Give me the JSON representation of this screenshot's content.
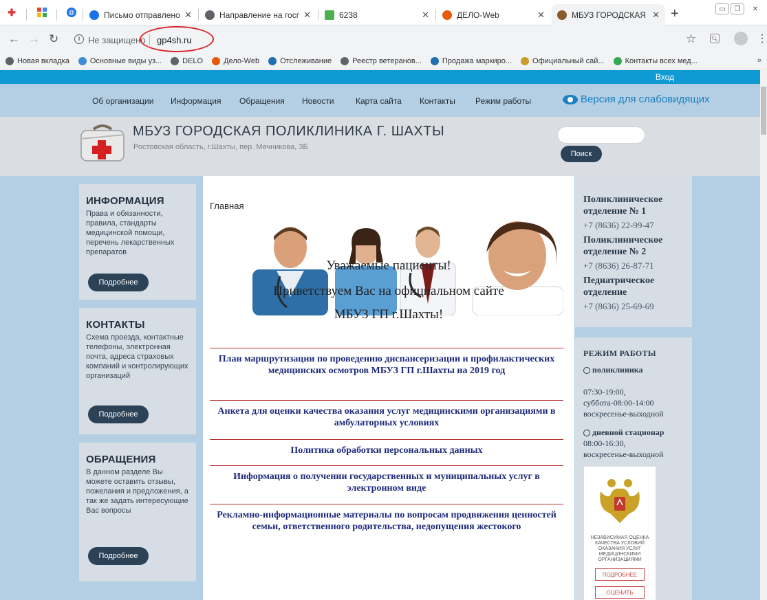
{
  "browser": {
    "tabs": [
      {
        "label": "Письмо отправлено - П",
        "favicon_color": "#1a73e8"
      },
      {
        "label": "Направление на госпит",
        "favicon_color": "#5f6368"
      },
      {
        "label": "6238",
        "favicon_color": "#4caf50"
      },
      {
        "label": "ДЕЛО-Web",
        "favicon_color": "#e8590c"
      },
      {
        "label": "МБУЗ ГОРОДСКАЯ ПОЛ",
        "favicon_color": "#8a5a2b"
      }
    ],
    "new_tab_label": "+",
    "security_text": "Не защищено",
    "url": "gp4sh.ru",
    "bookmarks": [
      {
        "label": "Новая вкладка",
        "color": "#5f6368"
      },
      {
        "label": "Основные виды уз...",
        "color": "#3d8bd6"
      },
      {
        "label": "DELO",
        "color": "#5f6368"
      },
      {
        "label": "Дело-Web",
        "color": "#e8590c"
      },
      {
        "label": "Отслеживание",
        "color": "#1f6fb2"
      },
      {
        "label": "Реестр ветеранов...",
        "color": "#5f6368"
      },
      {
        "label": "Продажа маркиро...",
        "color": "#1f6fb2"
      },
      {
        "label": "Официальный сай...",
        "color": "#c89b2b"
      },
      {
        "label": "Контакты всех мед...",
        "color": "#35a853"
      }
    ],
    "bookmarks_more": "»"
  },
  "site": {
    "login": "Вход",
    "nav": [
      "Об организации",
      "Информация",
      "Обращения",
      "Новости",
      "Карта сайта",
      "Контакты",
      "Режим работы"
    ],
    "accessibility": "Версия для слабовидящих",
    "title": "МБУЗ ГОРОДСКАЯ ПОЛИКЛИНИКА Г. ШАХТЫ",
    "address": "Ростовская область, г.Шахты, пер. Мечникова, 3Б",
    "search_button": "Поиск",
    "left_cards": [
      {
        "title": "ИНФОРМАЦИЯ",
        "text": "Права и обязанности, правила, стандарты медицинской помощи, перечень лекарственных препаратов",
        "button": "Подробнее"
      },
      {
        "title": "КОНТАКТЫ",
        "text": "Схема проезда, контактные телефоны, электронная почта, адреса страховых компаний и контролирующих организаций",
        "button": "Подробнее"
      },
      {
        "title": "ОБРАЩЕНИЯ",
        "text": "В данном разделе Вы можете оставить отзывы, пожелания и предложения, а так же задать интересующие Вас вопросы",
        "button": "Подробнее"
      }
    ],
    "breadcrumb": "Главная",
    "greeting": [
      "Уважаемые пациенты!",
      "Приветствуем Вас на официальном сайте",
      "МБУЗ ГП г.Шахты!"
    ],
    "links": [
      "План маршрутизации по проведению диспансеризации и профилактических медицинских осмотров МБУЗ ГП г.Шахты на 2019 год",
      "Анкета для оценки качества оказания услуг медицинскими организациями в амбулаторных условиях",
      "Политика обработки персональных данных",
      "Информация о получении государственных и муниципальных услуг в электронном виде",
      "Рекламно-информационные материалы по вопросам продвижения ценностей семьи, ответственного родительства, недопущения жестокого"
    ],
    "departments": [
      {
        "name": "Поликлиническое отделение № 1",
        "phone": "+7 (8636) 22-99-47"
      },
      {
        "name": "Поликлиническое отделение № 2",
        "phone": "+7 (8636) 26-87-71"
      },
      {
        "name": "Педиатрическое отделение",
        "phone": "+7 (8636) 25-69-69"
      }
    ],
    "hours": {
      "title": "РЕЖИМ РАБОТЫ",
      "clinic_label": "поликлиника",
      "clinic_lines": [
        "07:30-19:00,",
        "суббота-08:00-14:00",
        "воскресенье-выходной"
      ],
      "daycare_label": "дневной стационар",
      "daycare_lines": [
        "08:00-16:30,",
        "воскресенье-выходной"
      ]
    },
    "badge": {
      "text": "Независимая оценка качества условий оказания услуг медицинскими организациями",
      "more": "ПОДРОБНЕЕ",
      "rate": "ОЦЕНИТЬ"
    }
  },
  "colors": {
    "top_strip": "#0f9ad3",
    "page_bg": "#b4cfe3",
    "button_dark": "#2b4257",
    "link_blue": "#1e2b7a",
    "divider_red": "#b32f2f",
    "annotation_red": "#d9262b"
  }
}
